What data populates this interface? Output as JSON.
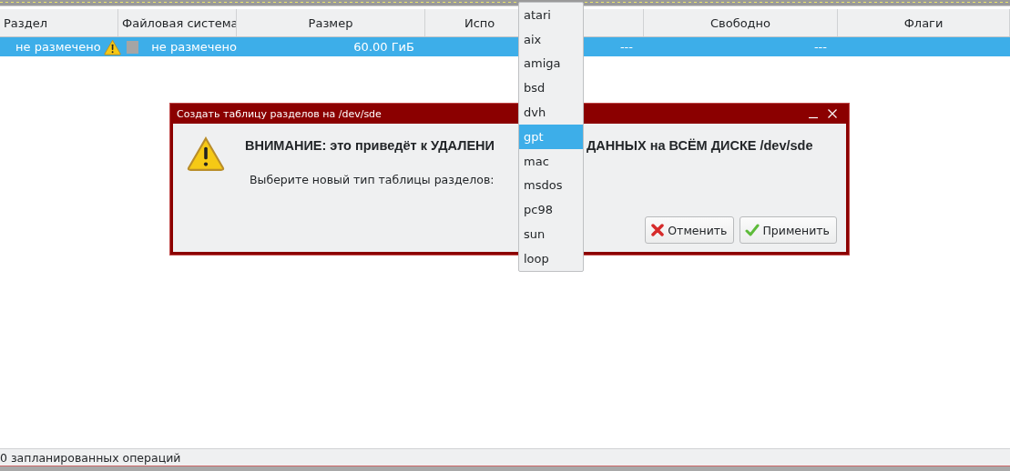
{
  "table": {
    "columns": [
      {
        "label": "Раздел"
      },
      {
        "label": "Файловая система"
      },
      {
        "label": "Размер"
      },
      {
        "label": "Испо"
      },
      {
        "label": "Свободно"
      },
      {
        "label": "Флаги"
      }
    ],
    "rows": [
      {
        "selected": true,
        "partition": "не размечено",
        "warning": true,
        "filesystem": "не размечено",
        "size": "60.00 ГиБ",
        "used": "---",
        "free": "---"
      }
    ]
  },
  "dialog": {
    "title": "Создать таблицу разделов на /dev/sde",
    "heading_start": "ВНИМАНИЕ: это приведёт к УДАЛЕНИ",
    "heading_end": "ДАННЫХ на ВСЁМ ДИСКЕ /dev/sde",
    "prompt": "Выберите новый тип таблицы разделов:",
    "buttons": [
      {
        "label": "Отменить",
        "kind": "cancel"
      },
      {
        "label": "Применить",
        "kind": "apply"
      }
    ]
  },
  "dropdown": {
    "items": [
      {
        "label": "atari",
        "selected": false
      },
      {
        "label": "aix",
        "selected": false
      },
      {
        "label": "amiga",
        "selected": false
      },
      {
        "label": "bsd",
        "selected": false
      },
      {
        "label": "dvh",
        "selected": false
      },
      {
        "label": "gpt",
        "selected": true
      },
      {
        "label": "mac",
        "selected": false
      },
      {
        "label": "msdos",
        "selected": false
      },
      {
        "label": "pc98",
        "selected": false
      },
      {
        "label": "sun",
        "selected": false
      },
      {
        "label": "loop",
        "selected": false
      }
    ]
  },
  "status_bar": {
    "text": "0 запланированных операций"
  }
}
